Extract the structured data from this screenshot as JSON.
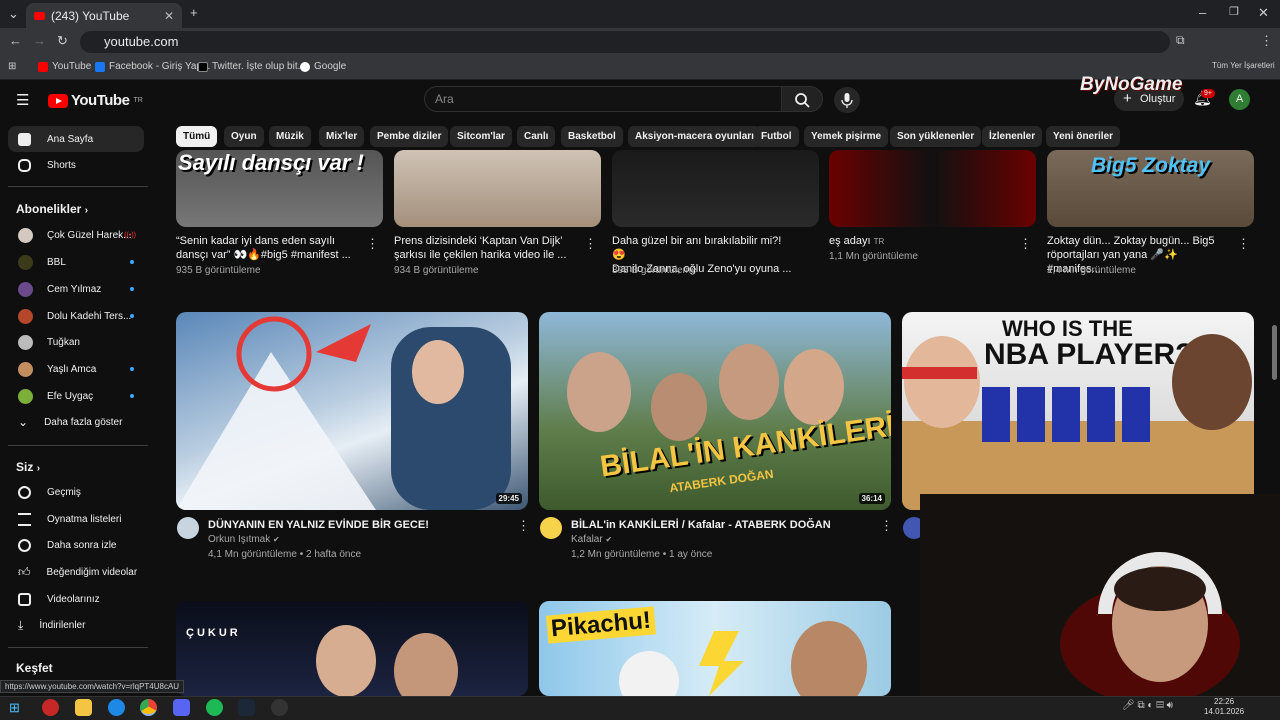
{
  "browser": {
    "tab_title": "(243) YouTube",
    "url": "youtube.com",
    "bookmarks": [
      "YouTube",
      "Facebook - Giriş Yap...",
      "Twitter. İşte olup bit...",
      "Google"
    ],
    "bookmarks_right": "Tüm Yer İşaretleri",
    "profile_initial": "A"
  },
  "youtube": {
    "logo_text": "YouTube",
    "logo_region": "TR",
    "search_placeholder": "Ara",
    "create_label": "Oluştur",
    "notif_badge": "9+",
    "avatar_initial": "A"
  },
  "watermark": "ByNoGame",
  "sidebar": {
    "top": [
      "Ana Sayfa",
      "Shorts"
    ],
    "subs_header": "Abonelikler",
    "subs": [
      "Çok Güzel Harek...",
      "BBL",
      "Cem Yılmaz",
      "Dolu Kadehi Ters...",
      "Tuğkan",
      "Yaşlı Amca",
      "Efe Uygaç"
    ],
    "show_more": "Daha fazla göster",
    "you_header": "Siz",
    "you_items": [
      "Geçmiş",
      "Oynatma listeleri",
      "Daha sonra izle",
      "Beğendiğim videolar",
      "Videolarınız",
      "İndirilenler"
    ],
    "explore_header": "Keşfet"
  },
  "chips": [
    "Tümü",
    "Oyun",
    "Müzik",
    "Mix'ler",
    "Pembe diziler",
    "Sitcom'lar",
    "Canlı",
    "Basketbol",
    "Aksiyon-macera oyunları",
    "Futbol",
    "Yemek pişirme",
    "Son yüklenenler",
    "İzlenenler",
    "Yeni öneriler"
  ],
  "shorts_row": [
    {
      "line1": "“Senin kadar iyi dans eden sayılı",
      "line2": "dansçı var” 👀🔥#big5 #manifest ...",
      "views": "935 B görüntüleme",
      "thumb_text": "Sayılı dansçı var !"
    },
    {
      "line1": "Prens dizisindeki ‘Kaptan Van Dijk’",
      "line2": "şarkısı ile çekilen harika video ile ...",
      "views": "934 B görüntüleme"
    },
    {
      "line1": "Daha güzel bir anı bırakılabilir mi?! 😍",
      "line2": "Danilo Zanna, oğlu Zeno'yu oyuna ...",
      "views": "398 B görüntüleme"
    },
    {
      "line1": "eş adayı",
      "line2": "",
      "views": "1,1 Mn görüntüleme",
      "badge": "TR"
    },
    {
      "line1": "Zoktay dün... Zoktay bugün... Big5",
      "line2": "röportajları yan yana 🎤✨ #manifes...",
      "views": "1,4 Mn görüntüleme",
      "thumb_text": "Big5 Zoktay"
    }
  ],
  "videos": [
    {
      "title": "DÜNYANIN EN YALNIZ EVİNDE BİR GECE!",
      "channel": "Orkun Işıtmak",
      "meta": "4,1 Mn görüntüleme • 2 hafta önce",
      "duration": "29:45"
    },
    {
      "title": "BİLAL'in KANKİLERİ / Kafalar - ATABERK DOĞAN",
      "channel": "Kafalar",
      "meta": "1,2 Mn görüntüleme • 1 ay önce",
      "duration": "36:14",
      "thumb_text": "BİLAL'İN KANKİLERİ",
      "thumb_sub": "ATABERK DOĞAN"
    },
    {
      "title": "",
      "channel": "",
      "meta": "",
      "duration": "",
      "thumb_text": "WHO IS THE",
      "thumb_text2": "NBA PLAYER?"
    }
  ],
  "bottom_row": [
    {
      "thumb_text": "ÇUKUR"
    },
    {
      "thumb_text": "Pikachu!"
    }
  ],
  "status_url": "https://www.youtube.com/watch?v=rlqPT4U8cAU",
  "clock": {
    "time": "22:26",
    "date": "14.01.2026"
  }
}
